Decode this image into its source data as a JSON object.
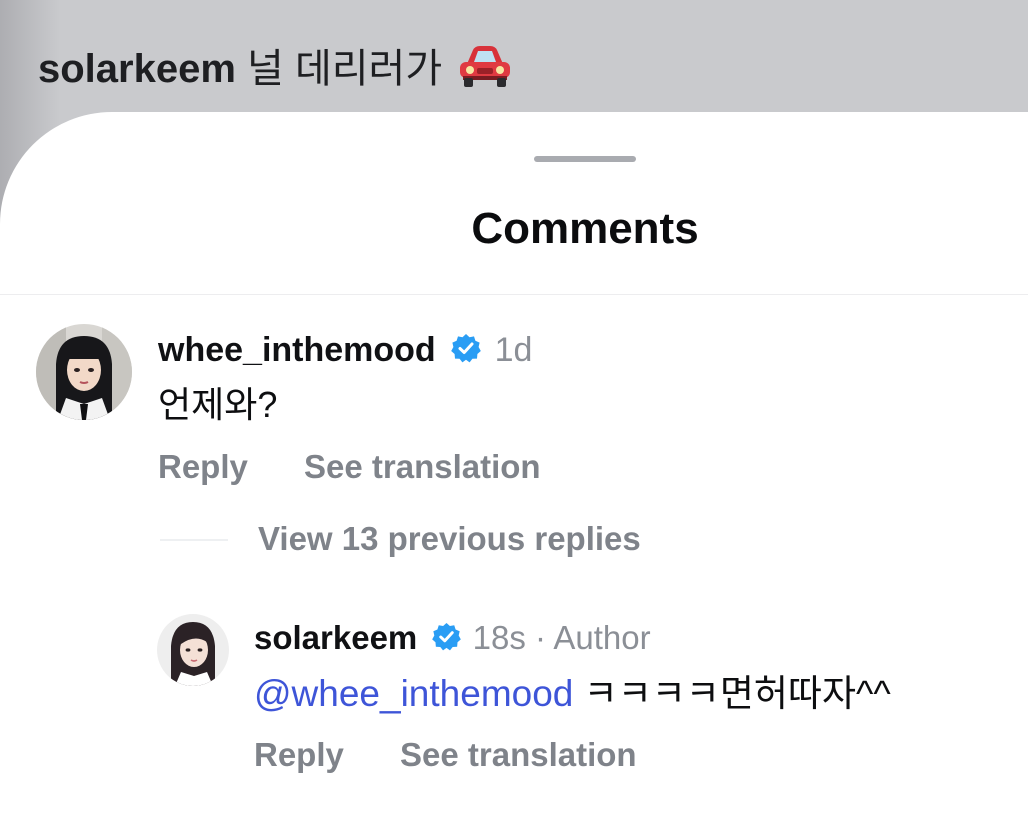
{
  "post": {
    "username": "solarkeem",
    "caption": "널 데리러가",
    "emoji": "car-icon"
  },
  "sheet": {
    "title": "Comments"
  },
  "comments": [
    {
      "username": "whee_inthemood",
      "verified": true,
      "time": "1d",
      "text": "언제와?",
      "reply_label": "Reply",
      "translate_label": "See translation"
    }
  ],
  "view_replies": {
    "label": "View 13 previous replies"
  },
  "replies": [
    {
      "username": "solarkeem",
      "verified": true,
      "time": "18s",
      "separator": "·",
      "badge": "Author",
      "mention": "@whee_inthemood",
      "text": "ㅋㅋㅋㅋ면허따자^^",
      "reply_label": "Reply",
      "translate_label": "See translation"
    }
  ],
  "colors": {
    "verified": "#2a9df4",
    "mention": "#3e55d8",
    "meta": "#8b8f96",
    "action": "#7f838a"
  }
}
